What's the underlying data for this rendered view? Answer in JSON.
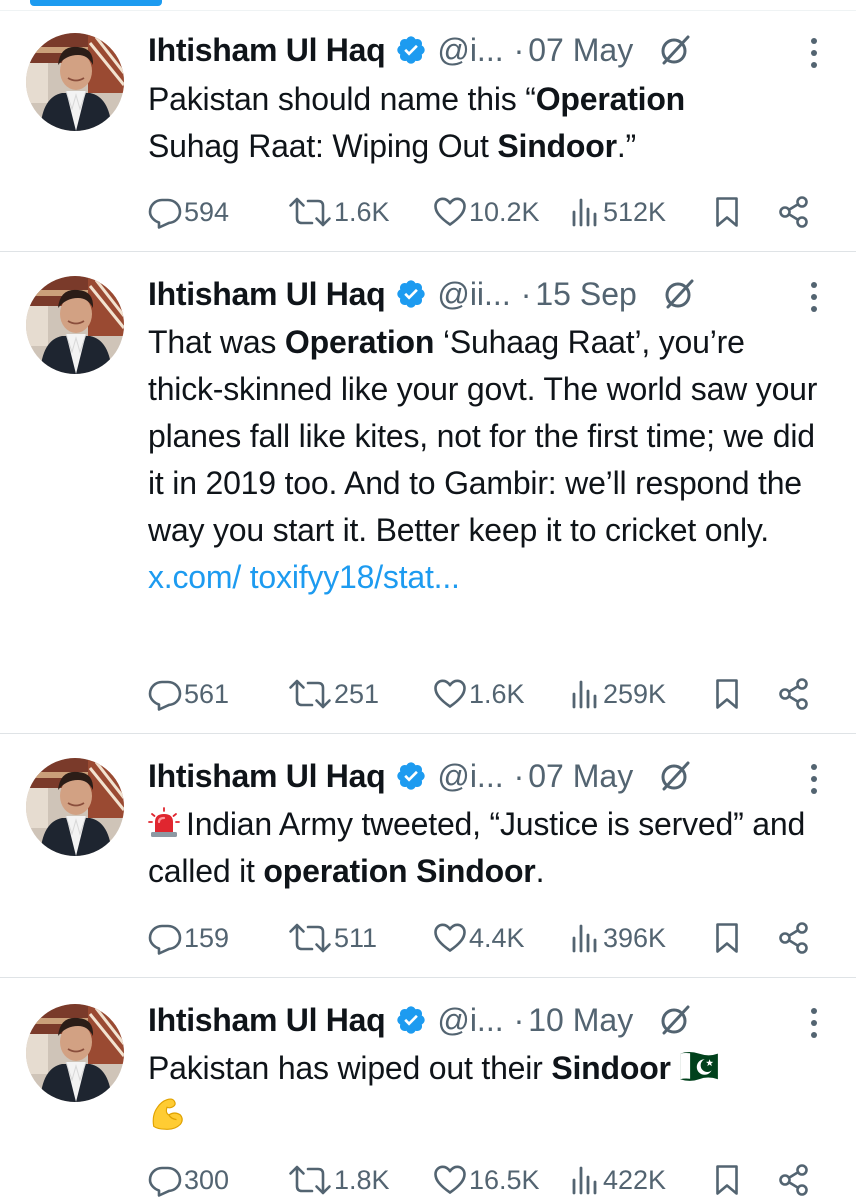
{
  "tweets": [
    {
      "name": "Ihtisham Ul Haq",
      "handle": "@i...",
      "dot": "·",
      "date": "07 May",
      "text_parts": [
        "Pakistan should name this “",
        "Operation",
        "Suhag Raat: Wiping Out ",
        "Sindoor",
        ".”"
      ],
      "replies": "594",
      "retweets": "1.6K",
      "likes": "10.2K",
      "views": "512K"
    },
    {
      "name": "Ihtisham Ul Haq",
      "handle": "@ii...",
      "dot": "·",
      "date": "15 Sep",
      "text_parts": [
        "That was ",
        "Operation",
        " ‘Suhaag Raat’, you’re thick-skinned like your govt. The world saw your planes fall like kites, not for the first time; we did it in 2019 too. And to Gambir: we’ll respond the way you start it. Better keep it to cricket only. "
      ],
      "link_text": "x.com/ toxifyy18/stat...",
      "replies": "561",
      "retweets": "251",
      "likes": "1.6K",
      "views": "259K"
    },
    {
      "name": "Ihtisham Ul Haq",
      "handle": "@i...",
      "dot": "·",
      "date": "07 May",
      "emoji": "police-light-emoji",
      "text_parts": [
        "Indian Army tweeted, “Justice is served” and called it ",
        "operation Sindoor",
        "."
      ],
      "replies": "159",
      "retweets": "511",
      "likes": "4.4K",
      "views": "396K"
    },
    {
      "name": "Ihtisham Ul Haq",
      "handle": "@i...",
      "dot": "·",
      "date": "10 May",
      "text_parts": [
        "Pakistan has wiped out their ",
        "Sindoor"
      ],
      "trailing_emojis": [
        "pakistan-flag-emoji",
        "flexed-biceps-emoji"
      ],
      "replies": "300",
      "retweets": "1.8K",
      "likes": "16.5K",
      "views": "422K"
    }
  ],
  "colors": {
    "accent": "#1d9bf0",
    "muted": "#536471",
    "text": "#0f1419"
  }
}
